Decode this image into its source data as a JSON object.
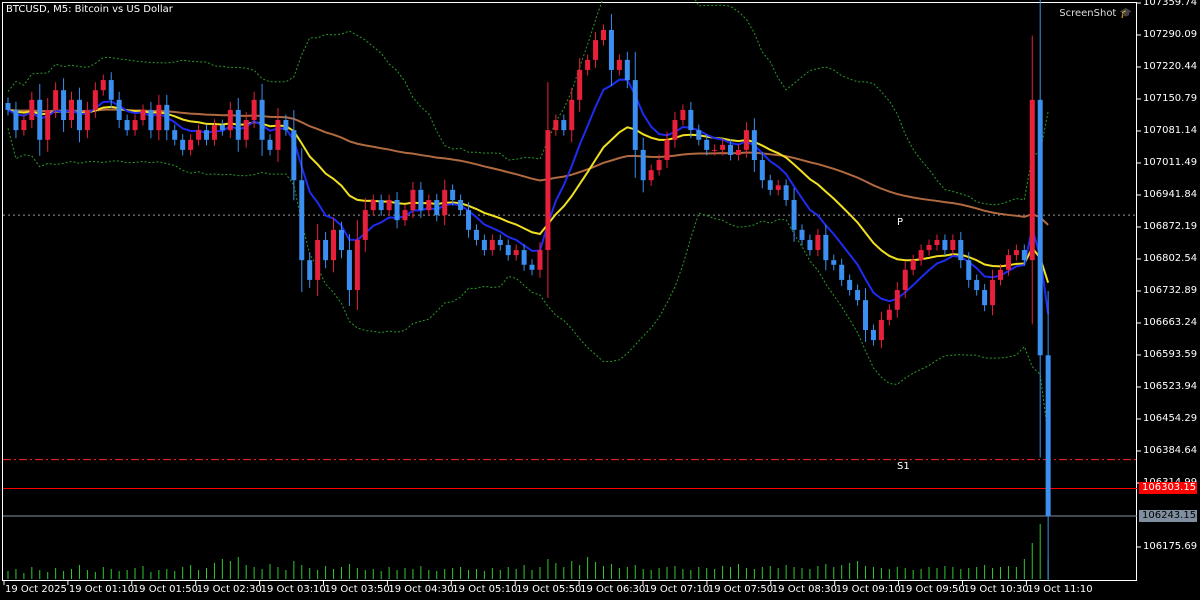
{
  "title": "BTCUSD, M5:  Bitcoin vs US Dollar",
  "screenshot_label": "ScreenShot",
  "chart_data": {
    "type": "candlestick",
    "symbol": "BTCUSD",
    "timeframe": "M5",
    "y_ticks": [
      "107359.74",
      "107290.09",
      "107220.44",
      "107150.79",
      "107081.14",
      "107011.49",
      "106941.84",
      "106872.19",
      "106802.54",
      "106732.89",
      "106663.24",
      "106593.59",
      "106523.94",
      "106454.29",
      "106384.64",
      "106314.99",
      "106175.69"
    ],
    "ylim": [
      106175.69,
      107359.74
    ],
    "x_ticks": [
      "19 Oct 2025",
      "19 Oct 01:10",
      "19 Oct 01:50",
      "19 Oct 02:30",
      "19 Oct 03:10",
      "19 Oct 03:50",
      "19 Oct 04:30",
      "19 Oct 05:10",
      "19 Oct 05:50",
      "19 Oct 06:30",
      "19 Oct 07:10",
      "19 Oct 07:50",
      "19 Oct 08:30",
      "19 Oct 09:10",
      "19 Oct 09:50",
      "19 Oct 10:30",
      "19 Oct 11:10"
    ],
    "closes": [
      107127,
      107083,
      107105,
      107149,
      107062,
      107127,
      107170,
      107105,
      107149,
      107083,
      107127,
      107170,
      107192,
      107149,
      107105,
      107083,
      107105,
      107127,
      107083,
      107138,
      107083,
      107062,
      107040,
      107062,
      107083,
      107062,
      107094,
      107083,
      107127,
      107062,
      107105,
      107149,
      107062,
      107040,
      107105,
      107083,
      106974,
      106800,
      106757,
      106844,
      106800,
      106866,
      106822,
      106735,
      106844,
      106909,
      106931,
      106909,
      106931,
      106887,
      106909,
      106953,
      106909,
      106931,
      106898,
      106953,
      106931,
      106909,
      106866,
      106844,
      106822,
      106844,
      106833,
      106811,
      106822,
      106790,
      106779,
      106822,
      107083,
      107105,
      107083,
      107149,
      107214,
      107236,
      107279,
      107301,
      107214,
      107236,
      107192,
      107040,
      106974,
      106996,
      107018,
      107062,
      107105,
      107127,
      107083,
      107062,
      107040,
      107040,
      107051,
      107029,
      107040,
      107083,
      107018,
      106974,
      106953,
      106963,
      106931,
      106866,
      106844,
      106822,
      106855,
      106800,
      106790,
      106757,
      106735,
      106713,
      106648,
      106626,
      106670,
      106692,
      106735,
      106779,
      106800,
      106822,
      106833,
      106844,
      106822,
      106844,
      106800,
      106757,
      106735,
      106702,
      106757,
      106779,
      106811,
      106822,
      106800,
      107149,
      106593,
      106243
    ],
    "volumes": [
      8,
      10,
      6,
      12,
      9,
      7,
      11,
      8,
      10,
      14,
      9,
      7,
      12,
      10,
      8,
      9,
      11,
      13,
      7,
      9,
      10,
      8,
      12,
      14,
      9,
      11,
      16,
      20,
      18,
      22,
      14,
      12,
      10,
      15,
      12,
      9,
      18,
      14,
      11,
      9,
      13,
      10,
      12,
      15,
      11,
      9,
      10,
      8,
      12,
      9,
      11,
      10,
      13,
      9,
      8,
      10,
      11,
      12,
      9,
      10,
      8,
      11,
      9,
      12,
      10,
      14,
      9,
      12,
      20,
      16,
      12,
      18,
      14,
      22,
      17,
      13,
      15,
      11,
      12,
      14,
      10,
      9,
      11,
      12,
      13,
      10,
      9,
      12,
      11,
      10,
      13,
      12,
      15,
      11,
      10,
      12,
      13,
      11,
      14,
      12,
      11,
      10,
      13,
      15,
      12,
      14,
      16,
      18,
      13,
      12,
      11,
      10,
      12,
      11,
      9,
      10,
      12,
      11,
      13,
      12,
      10,
      11,
      12,
      14,
      11,
      12,
      13,
      12,
      20,
      36,
      55,
      20
    ],
    "levels": [
      {
        "name": "P",
        "price": 106898,
        "color": "#9a9a9a",
        "style": "dotted"
      },
      {
        "name": "S1",
        "price": 106366,
        "color": "#ff2020",
        "style": "dashdot"
      },
      {
        "name": "bid",
        "price": 106303.15,
        "color": "#ff0000",
        "style": "solid",
        "label": "106303.15"
      },
      {
        "name": "last",
        "price": 106243.15,
        "color": "#7f8fa0",
        "style": "solid",
        "label": "106243.15"
      }
    ],
    "colors": {
      "bull": "#e8203c",
      "bear": "#3a8ff0",
      "ma_fast": "#1d2cf0",
      "ma_mid": "#f0e020",
      "ma_slow": "#b06a40",
      "bands": "#2a9a2a",
      "volume": "#2ecc2e"
    }
  }
}
